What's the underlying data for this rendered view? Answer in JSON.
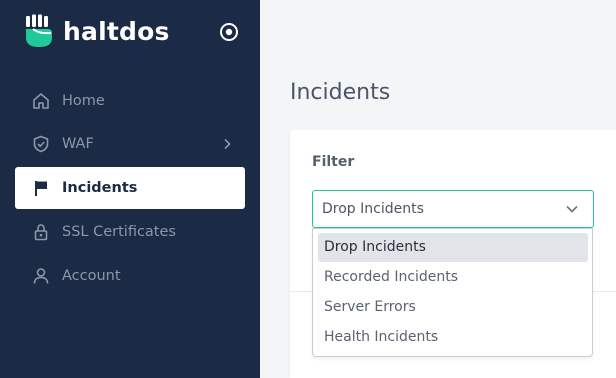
{
  "sidebar": {
    "brand": {
      "name": "haltdos",
      "logo_icon": "fist-logo-icon",
      "brand_color": "#20c997"
    },
    "collapse_icon": "target-circle-icon",
    "items": [
      {
        "label": "Home",
        "icon": "home-icon"
      },
      {
        "label": "WAF",
        "icon": "shield-check-icon",
        "has_submenu": true
      },
      {
        "label": "Incidents",
        "icon": "flag-icon",
        "active": true
      },
      {
        "label": "SSL Certificates",
        "icon": "lock-icon"
      },
      {
        "label": "Account",
        "icon": "user-icon"
      }
    ],
    "background": "#1b2a45"
  },
  "main": {
    "page_title": "Incidents",
    "filter": {
      "label": "Filter",
      "selected": "Drop Incidents",
      "options": [
        "Drop Incidents",
        "Recorded Incidents",
        "Server Errors",
        "Health Incidents"
      ],
      "accent": "#20c997"
    }
  }
}
